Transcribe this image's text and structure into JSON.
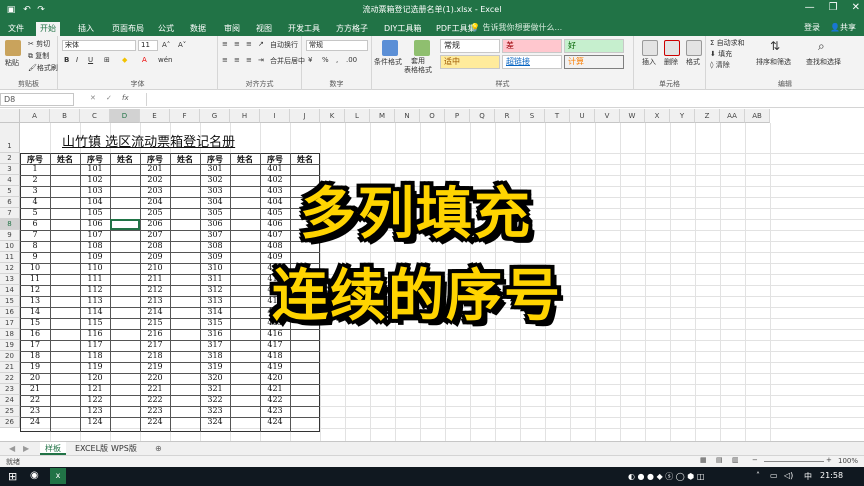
{
  "window": {
    "title": "流动票箱登记选册名单(1).xlsx - Excel"
  },
  "tabs": [
    "文件",
    "开始",
    "插入",
    "页面布局",
    "公式",
    "数据",
    "审阅",
    "视图",
    "开发工具",
    "方方格子",
    "DIY工具箱",
    "PDF工具集"
  ],
  "tell_me": "告诉我你想要做什么...",
  "account": {
    "login": "登录",
    "share": "共享"
  },
  "ribbon": {
    "clipboard": {
      "paste": "粘贴",
      "cut": "剪切",
      "copy": "复制",
      "format_painter": "格式刷",
      "label": "剪贴板"
    },
    "font": {
      "name": "宋体",
      "size": "11",
      "label": "字体"
    },
    "alignment": {
      "wrap": "自动换行",
      "merge": "合并后居中",
      "label": "对齐方式"
    },
    "number": {
      "format": "常规",
      "label": "数字"
    },
    "styles": {
      "conditional": "条件格式",
      "table": "套用\n表格格式",
      "cells": [
        "常规",
        "差",
        "好",
        "适中",
        "超链接",
        "计算"
      ],
      "label": "样式"
    },
    "cells_group": {
      "insert": "插入",
      "delete": "删除",
      "format": "格式",
      "label": "单元格"
    },
    "editing": {
      "autosum": "自动求和",
      "fill": "填充",
      "clear": "清除",
      "sort": "排序和筛选",
      "find": "查找和选择",
      "label": "编辑"
    }
  },
  "formula_bar": {
    "name_box": "D8",
    "fx": "fx",
    "value": ""
  },
  "columns": [
    "A",
    "B",
    "C",
    "D",
    "E",
    "F",
    "G",
    "H",
    "I",
    "J",
    "K",
    "L",
    "M",
    "N",
    "O",
    "P",
    "Q",
    "R",
    "S",
    "T",
    "U",
    "V",
    "W",
    "X",
    "Y",
    "Z",
    "AA",
    "AB"
  ],
  "sheet_title": "山竹镇    选区流动票箱登记名册",
  "header_row": [
    "序号",
    "姓名",
    "序号",
    "姓名",
    "序号",
    "姓名",
    "序号",
    "姓名",
    "序号",
    "姓名"
  ],
  "row_numbers": [
    "1",
    "2",
    "3",
    "4",
    "5",
    "6",
    "7",
    "8",
    "9",
    "10",
    "11",
    "12",
    "13",
    "14",
    "15",
    "16",
    "17",
    "18",
    "19",
    "20",
    "21",
    "22",
    "23",
    "24",
    "25",
    "26"
  ],
  "col_a": [
    "1",
    "2",
    "3",
    "4",
    "5",
    "6",
    "7",
    "8",
    "9",
    "10",
    "11",
    "12",
    "13",
    "14",
    "15",
    "16",
    "17",
    "18",
    "19",
    "20",
    "21",
    "22",
    "23",
    "24"
  ],
  "col_c": [
    "101",
    "102",
    "103",
    "104",
    "105",
    "106",
    "107",
    "108",
    "109",
    "110",
    "111",
    "112",
    "113",
    "114",
    "115",
    "116",
    "117",
    "118",
    "119",
    "120",
    "121",
    "122",
    "123",
    "124"
  ],
  "col_e": [
    "201",
    "202",
    "203",
    "204",
    "205",
    "206",
    "207",
    "208",
    "209",
    "210",
    "211",
    "212",
    "213",
    "214",
    "215",
    "216",
    "217",
    "218",
    "219",
    "220",
    "221",
    "222",
    "223",
    "224"
  ],
  "col_g": [
    "301",
    "302",
    "303",
    "304",
    "305",
    "306",
    "307",
    "308",
    "309",
    "310",
    "311",
    "312",
    "313",
    "314",
    "315",
    "316",
    "317",
    "318",
    "319",
    "320",
    "321",
    "322",
    "323",
    "324"
  ],
  "col_i": [
    "401",
    "402",
    "403",
    "404",
    "405",
    "406",
    "407",
    "408",
    "409",
    "410",
    "411",
    "412",
    "413",
    "414",
    "415",
    "416",
    "417",
    "418",
    "419",
    "420",
    "421",
    "422",
    "423",
    "424"
  ],
  "overlay": {
    "line1": "多列填充",
    "line2": "连续的序号"
  },
  "sheet_tabs": [
    "样板",
    "EXCEL版",
    "WPS版"
  ],
  "status": {
    "ready": "就绪",
    "zoom": "100%"
  },
  "taskbar": {
    "lang": "中",
    "time": "21:58"
  }
}
